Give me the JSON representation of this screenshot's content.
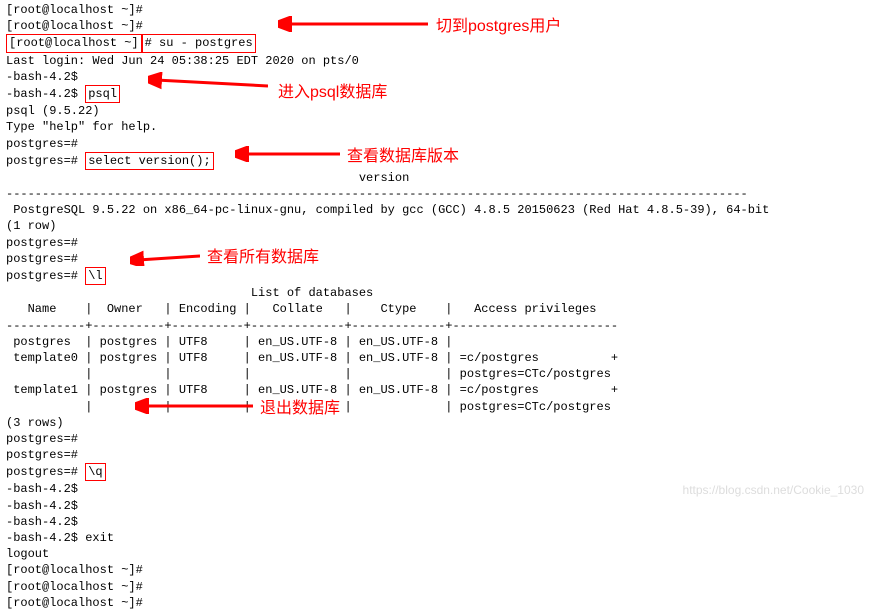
{
  "lines": {
    "l1": "[root@localhost ~]#",
    "l2a": "[root@localhost ~]#",
    "l2b": "[root@localhost ~]",
    "l2c": "# su - postgres",
    "l3": "Last login: Wed Jun 24 05:38:25 EDT 2020 on pts/0",
    "l4": "-bash-4.2$",
    "l5a": "-bash-4.2$ ",
    "l5b": "psql",
    "l6": "psql (9.5.22)",
    "l7": "Type \"help\" for help.",
    "l8": "",
    "l9": "postgres=#",
    "l10a": "postgres=# ",
    "l10b": "select version();",
    "l11": "                                                 version",
    "l12": "-------------------------------------------------------------------------------------------------------",
    "l13": " PostgreSQL 9.5.22 on x86_64-pc-linux-gnu, compiled by gcc (GCC) 4.8.5 20150623 (Red Hat 4.8.5-39), 64-bit",
    "l14": "(1 row)",
    "l15": "",
    "l16": "postgres=#",
    "l17": "postgres=#",
    "l18a": "postgres=# ",
    "l18b": "\\l",
    "l19": "                                  List of databases",
    "l20": "   Name    |  Owner   | Encoding |   Collate   |    Ctype    |   Access privileges",
    "l21": "-----------+----------+----------+-------------+-------------+-----------------------",
    "l22": " postgres  | postgres | UTF8     | en_US.UTF-8 | en_US.UTF-8 |",
    "l23": " template0 | postgres | UTF8     | en_US.UTF-8 | en_US.UTF-8 | =c/postgres          +",
    "l24": "           |          |          |             |             | postgres=CTc/postgres",
    "l25": " template1 | postgres | UTF8     | en_US.UTF-8 | en_US.UTF-8 | =c/postgres          +",
    "l26": "           |          |          |             |             | postgres=CTc/postgres",
    "l27": "(3 rows)",
    "l28": "",
    "l29": "postgres=#",
    "l30": "postgres=#",
    "l31a": "postgres=# ",
    "l31b": "\\q",
    "l32": "-bash-4.2$",
    "l33": "-bash-4.2$",
    "l34": "-bash-4.2$",
    "l35": "-bash-4.2$ exit",
    "l36": "logout",
    "l37": "[root@localhost ~]#",
    "l38": "[root@localhost ~]#",
    "l39": "[root@localhost ~]#"
  },
  "annotations": {
    "a1": "切到postgres用户",
    "a2": "进入psql数据库",
    "a3": "查看数据库版本",
    "a4": "查看所有数据库",
    "a5": "退出数据库"
  },
  "watermark": "https://blog.csdn.net/Cookie_1030"
}
